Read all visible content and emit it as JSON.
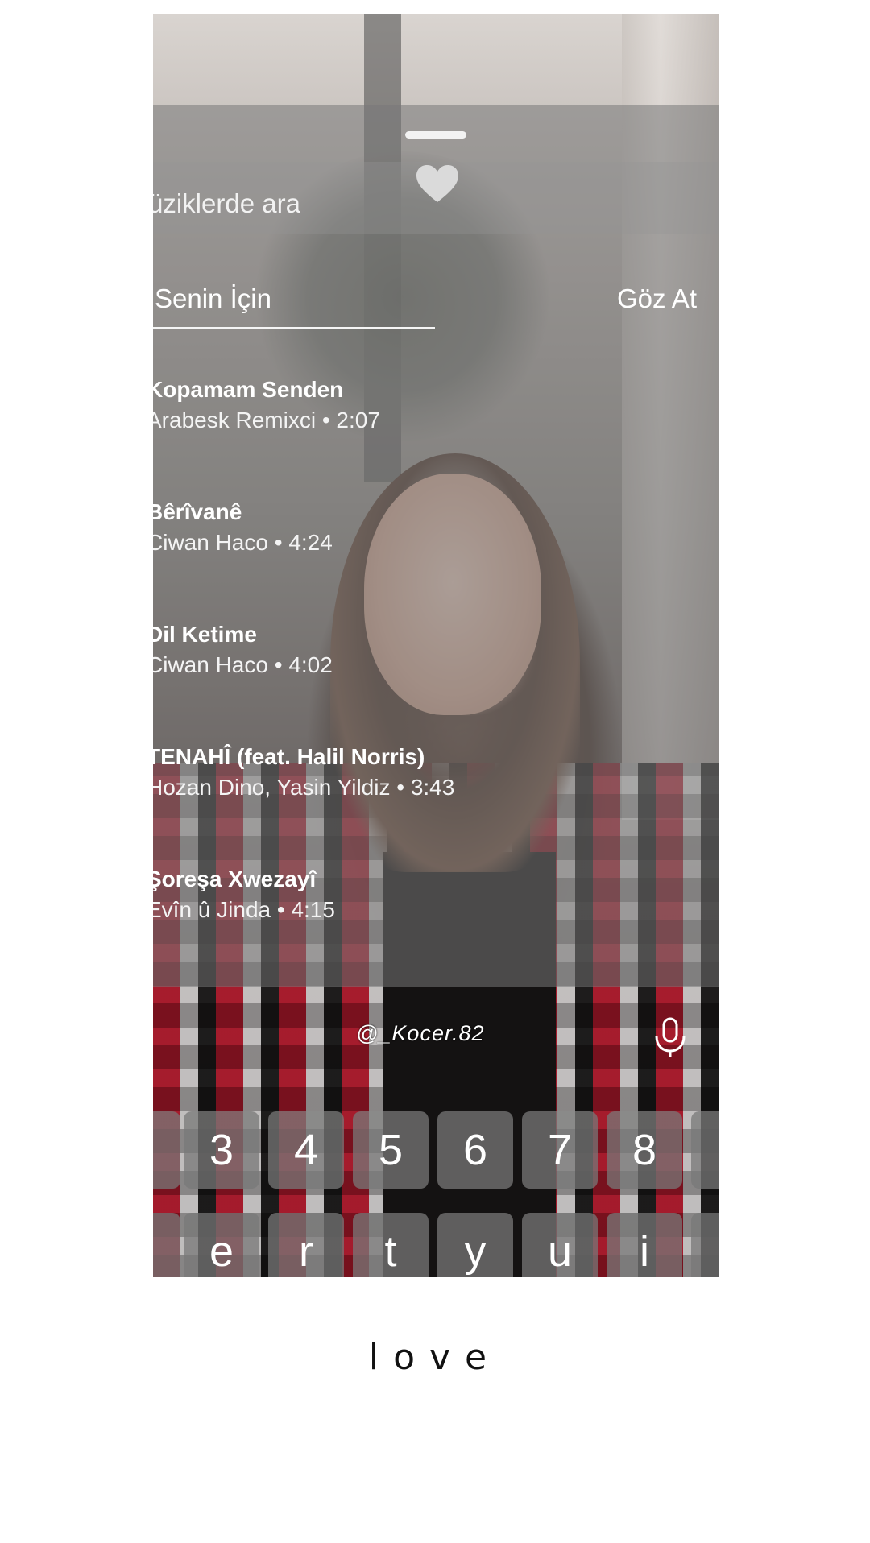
{
  "search": {
    "text": "üziklerde ara"
  },
  "tabs": {
    "for_you": "Senin İçin",
    "browse": "Göz At"
  },
  "songs": [
    {
      "title": "Kopamam Senden",
      "meta": "Arabesk Remixci • 2:07"
    },
    {
      "title": "Bêrîvanê",
      "meta": "Ciwan Haco • 4:24"
    },
    {
      "title": "Dil Ketime",
      "meta": "Ciwan Haco • 4:02"
    },
    {
      "title": "TENAHÎ (feat. Halil Norris)",
      "meta": "Hozan Dino, Yasin Yildiz • 3:43"
    },
    {
      "title": "Şoreşa Xwezayî",
      "meta": "Evîn û Jinda • 4:15"
    }
  ],
  "overlay": {
    "username": "@_Kocer.82"
  },
  "keyboard": {
    "number_row": [
      "3",
      "4",
      "5",
      "6",
      "7",
      "8"
    ],
    "letter_row": [
      "e",
      "r",
      "t",
      "y",
      "u",
      "i"
    ]
  },
  "caption": "love",
  "colors": {
    "sheet_overlay": "#787878",
    "text": "#ffffff"
  },
  "icons": {
    "heart": "heart-icon",
    "mic": "microphone-icon"
  }
}
